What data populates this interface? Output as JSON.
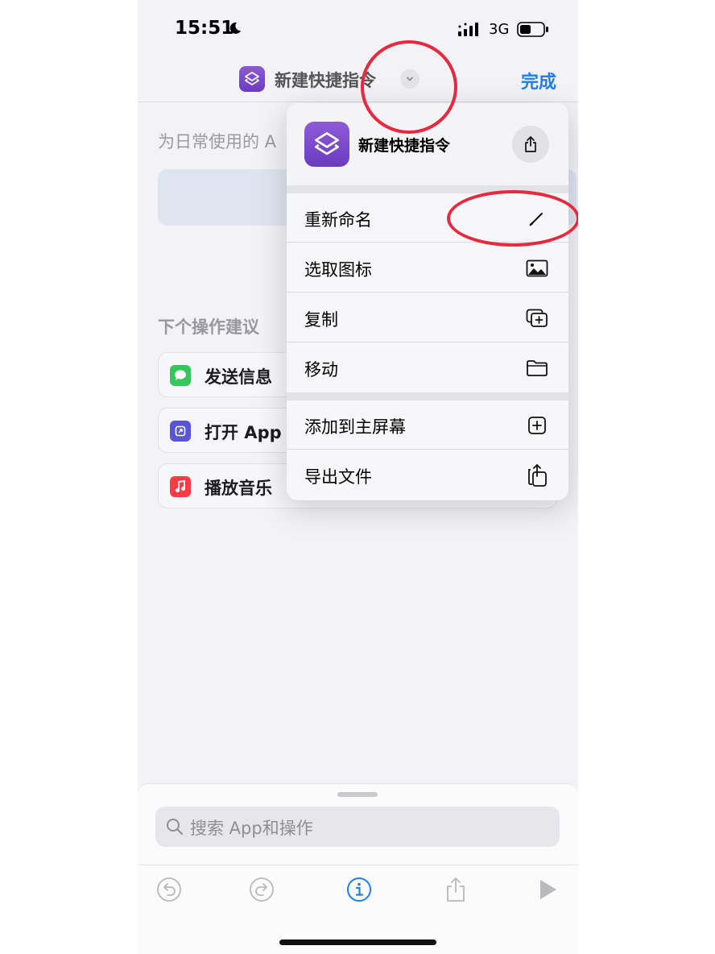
{
  "status_bar": {
    "time": "15:51",
    "network": "3G"
  },
  "nav": {
    "title": "新建快捷指令",
    "done": "完成"
  },
  "editor": {
    "description": "为日常使用的 A",
    "section_title": "下个操作建议",
    "suggestions": [
      {
        "label": "发送信息",
        "icon": "messages-icon",
        "color": "#34c759"
      },
      {
        "label": "打开 App",
        "icon": "open-app-icon",
        "color": "#5856d6"
      },
      {
        "label": "播放音乐",
        "icon": "music-icon",
        "color": "#fc3c44"
      }
    ]
  },
  "menu": {
    "title": "新建快捷指令",
    "items": [
      {
        "label": "重新命名",
        "icon": "pencil-icon"
      },
      {
        "label": "选取图标",
        "icon": "photo-icon"
      },
      {
        "label": "复制",
        "icon": "duplicate-icon"
      },
      {
        "label": "移动",
        "icon": "folder-icon"
      },
      {
        "label": "添加到主屏幕",
        "icon": "add-square-icon"
      },
      {
        "label": "导出文件",
        "icon": "export-icon"
      }
    ]
  },
  "search": {
    "placeholder": "搜索 App和操作"
  },
  "colors": {
    "accent": "#1f7ff0",
    "annotation": "#e8283f",
    "shortcut_purple": "#7b48cc"
  }
}
